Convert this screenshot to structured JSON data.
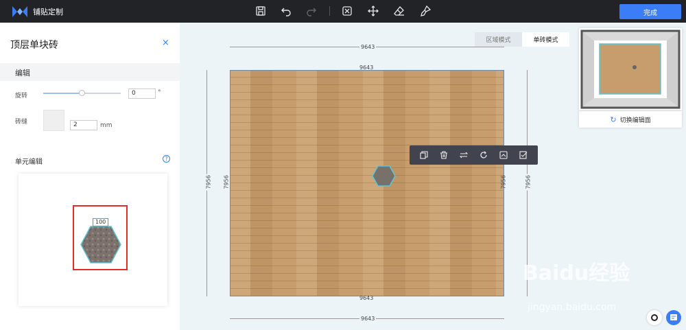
{
  "app": {
    "title": "铺贴定制",
    "done_label": "完成"
  },
  "toolbar": {
    "icons": [
      "save-icon",
      "undo-icon",
      "redo-icon",
      "fit-view-icon",
      "move-icon",
      "eraser-icon",
      "brush-icon"
    ]
  },
  "panel": {
    "title": "顶层单块砖",
    "close": "×",
    "section": "编辑",
    "rotate_label": "旋转",
    "rotate_value": "0",
    "rotate_unit": "°",
    "rotate_slider_fraction": 0.5,
    "grout_label": "砖缝",
    "grout_value": "2",
    "grout_unit": "mm",
    "unit_edit_label": "单元编辑",
    "help": "?",
    "unit_size": "100"
  },
  "canvas": {
    "width_dim": "9643",
    "height_dim": "7956",
    "modes": [
      "区域模式",
      "单砖模式"
    ],
    "active_mode": "单砖模式",
    "context_tools": [
      "duplicate-icon",
      "delete-icon",
      "swap-icon",
      "rotate-icon",
      "replace-icon",
      "check-edit-icon"
    ],
    "switch_edit_label": "切换编辑面"
  },
  "watermark": {
    "brand": "Baidu经验",
    "url": "jingyan.baidu.com"
  },
  "colors": {
    "topbar": "#222327",
    "accent": "#3b7df6",
    "highlight": "#e52b25",
    "canvas_bg": "#ecf4f8",
    "wood": "#c79d6d"
  }
}
